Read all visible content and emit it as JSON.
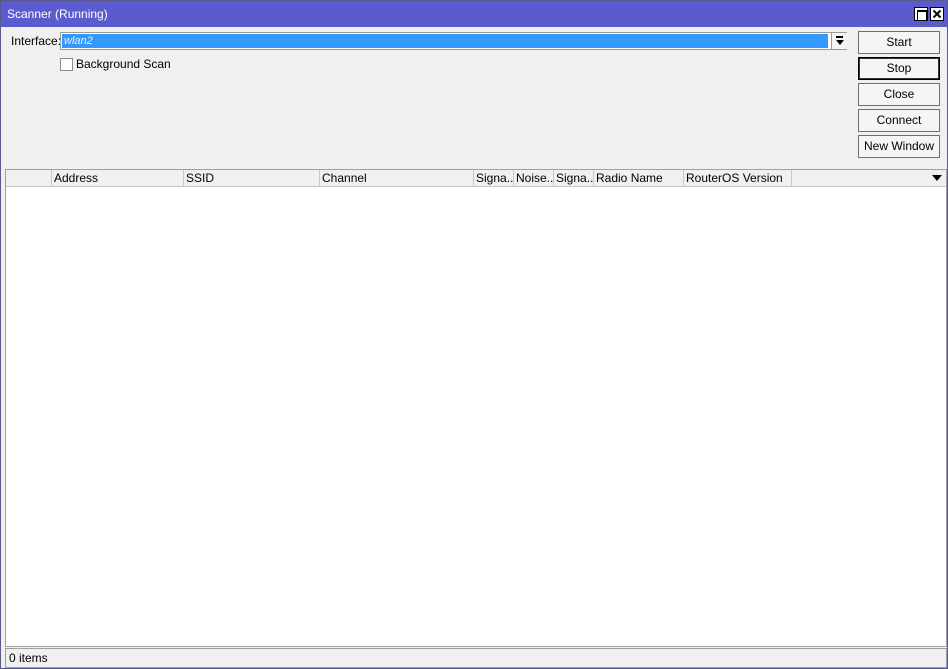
{
  "window": {
    "title": "Scanner (Running)"
  },
  "interface": {
    "label": "Interface:",
    "value": "wlan2"
  },
  "background_scan": {
    "label": "Background Scan",
    "checked": false
  },
  "buttons": {
    "start": "Start",
    "stop": "Stop",
    "close": "Close",
    "connect": "Connect",
    "new_window": "New Window"
  },
  "table": {
    "columns": [
      "",
      "Address",
      "SSID",
      "Channel",
      "Signa...",
      "Noise...",
      "Signa...",
      "Radio Name",
      "RouterOS Version"
    ],
    "rows": []
  },
  "status": {
    "items": "0 items"
  }
}
